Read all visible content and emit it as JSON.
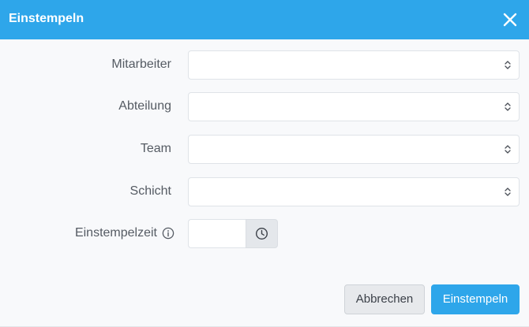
{
  "dialog": {
    "title": "Einstempeln"
  },
  "form": {
    "fields": [
      {
        "label": "Mitarbeiter",
        "value": ""
      },
      {
        "label": "Abteilung",
        "value": ""
      },
      {
        "label": "Team",
        "value": ""
      },
      {
        "label": "Schicht",
        "value": ""
      }
    ],
    "clock_in_time": {
      "label": "Einstempelzeit",
      "value": ""
    }
  },
  "footer": {
    "cancel_label": "Abbrechen",
    "submit_label": "Einstempeln"
  },
  "colors": {
    "accent": "#2ea6ea",
    "header_text": "#ffffff",
    "label_text": "#555b63",
    "background": "#f8f9fb"
  },
  "icons": {
    "close": "close-icon",
    "select": "chevron-up-down-icon",
    "info": "info-icon",
    "clock": "clock-icon"
  }
}
